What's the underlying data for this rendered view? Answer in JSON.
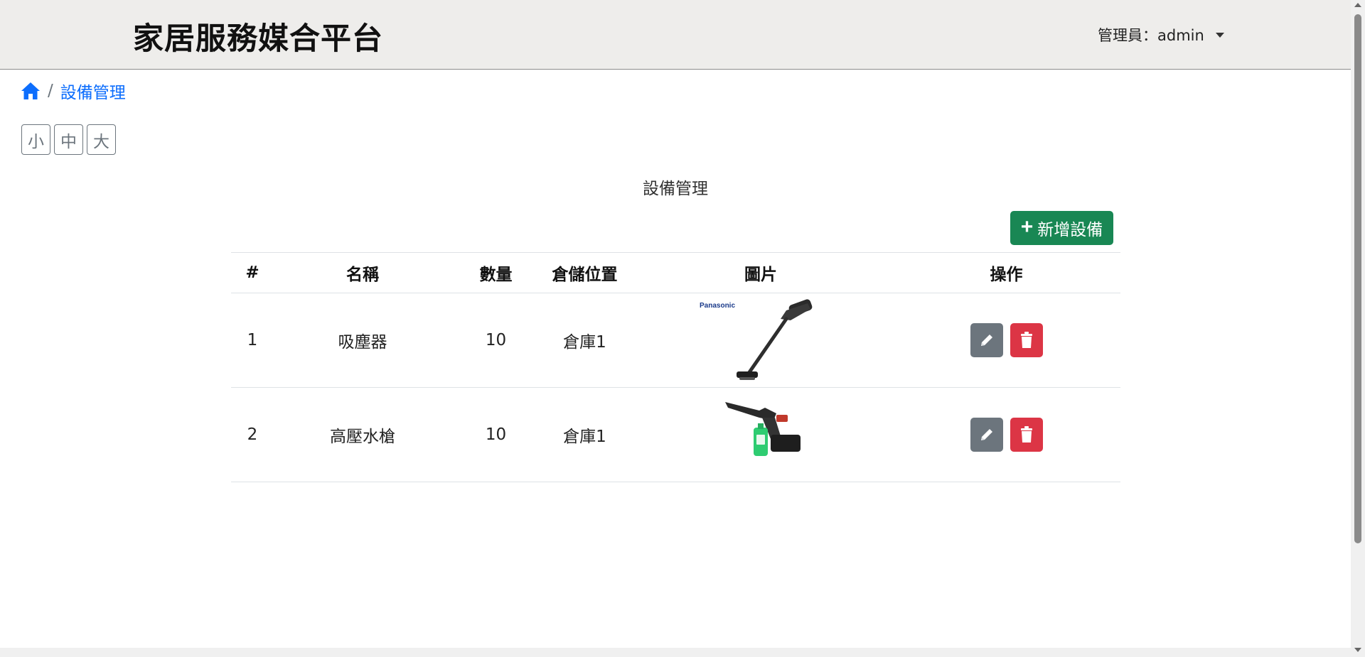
{
  "header": {
    "brand": "家居服務媒合平台",
    "user_menu": "管理員：admin"
  },
  "breadcrumb": {
    "separator": "/",
    "current": "設備管理"
  },
  "font_size_buttons": [
    "小",
    "中",
    "大"
  ],
  "page_title": "設備管理",
  "add_button_label": "新增設備",
  "table": {
    "headers": [
      "#",
      "名稱",
      "數量",
      "倉儲位置",
      "圖片",
      "操作"
    ],
    "rows": [
      {
        "id": "1",
        "name": "吸塵器",
        "quantity": "10",
        "location": "倉庫1",
        "image_logo": "Panasonic"
      },
      {
        "id": "2",
        "name": "高壓水槍",
        "quantity": "10",
        "location": "倉庫1",
        "image_logo": ""
      }
    ]
  },
  "colors": {
    "primary": "#0d6efd",
    "success": "#198754",
    "secondary": "#6c757d",
    "danger": "#dc3545",
    "navbar_bg": "#eeedeb"
  }
}
